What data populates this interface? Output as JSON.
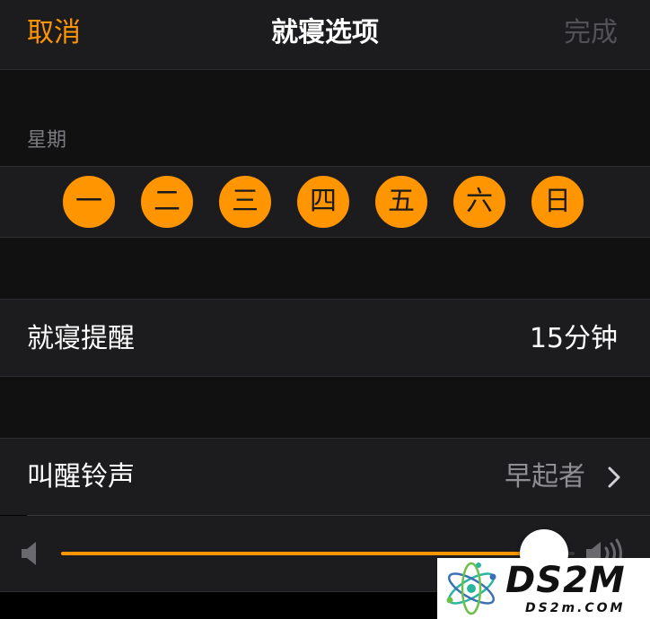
{
  "nav": {
    "cancel_label": "取消",
    "title": "就寝选项",
    "done_label": "完成"
  },
  "weekdays": {
    "header": "星期",
    "days": [
      {
        "label": "一",
        "selected": true
      },
      {
        "label": "二",
        "selected": true
      },
      {
        "label": "三",
        "selected": true
      },
      {
        "label": "四",
        "selected": true
      },
      {
        "label": "五",
        "selected": true
      },
      {
        "label": "六",
        "selected": true
      },
      {
        "label": "日",
        "selected": true
      }
    ]
  },
  "bedtime_reminder": {
    "label": "就寝提醒",
    "value": "15分钟"
  },
  "wake_up_sound": {
    "label": "叫醒铃声",
    "value": "早起者",
    "icon": "chevron-right-icon"
  },
  "volume": {
    "level": 0.94,
    "min_icon": "speaker-low-icon",
    "max_icon": "speaker-high-icon"
  },
  "colors": {
    "accent": "#ff9500",
    "background": "#000000",
    "cell": "#1c1c1e",
    "secondary_text": "#8e8e93",
    "disabled_text": "#525256"
  },
  "watermark": {
    "logo_text": "DS2M",
    "site_text": "DS2m.COM"
  }
}
